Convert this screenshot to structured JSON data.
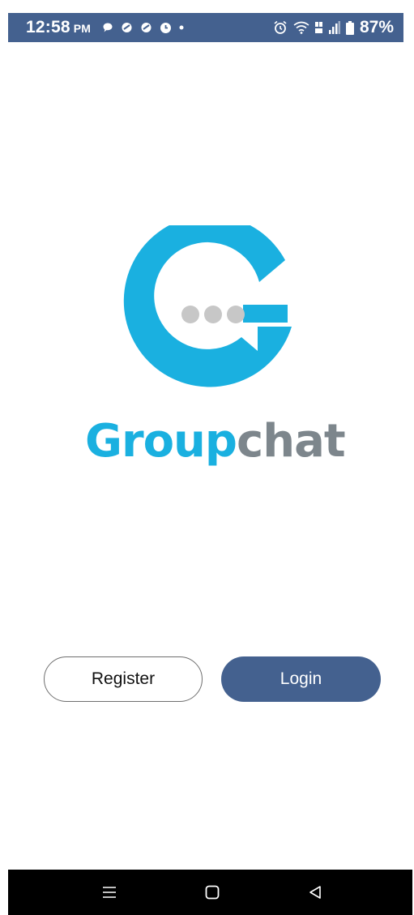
{
  "status_bar": {
    "time": "12:58",
    "ampm": "PM",
    "battery_percent": "87%",
    "notification_icons": [
      "chat-bubble-icon",
      "app-icon",
      "app-icon",
      "clock-app-icon",
      "dot-icon"
    ],
    "system_icons": [
      "alarm-icon",
      "wifi-icon",
      "lte-icon",
      "signal-icon",
      "battery-icon"
    ]
  },
  "logo": {
    "word1": "Group",
    "word2": "chat",
    "color_primary": "#1ab0e0",
    "color_secondary": "#7d868c"
  },
  "buttons": {
    "register_label": "Register",
    "login_label": "Login"
  },
  "nav_bar": {
    "icons": [
      "recents-icon",
      "home-icon",
      "back-icon"
    ]
  },
  "colors": {
    "accent": "#44618f",
    "background": "#ffffff"
  }
}
